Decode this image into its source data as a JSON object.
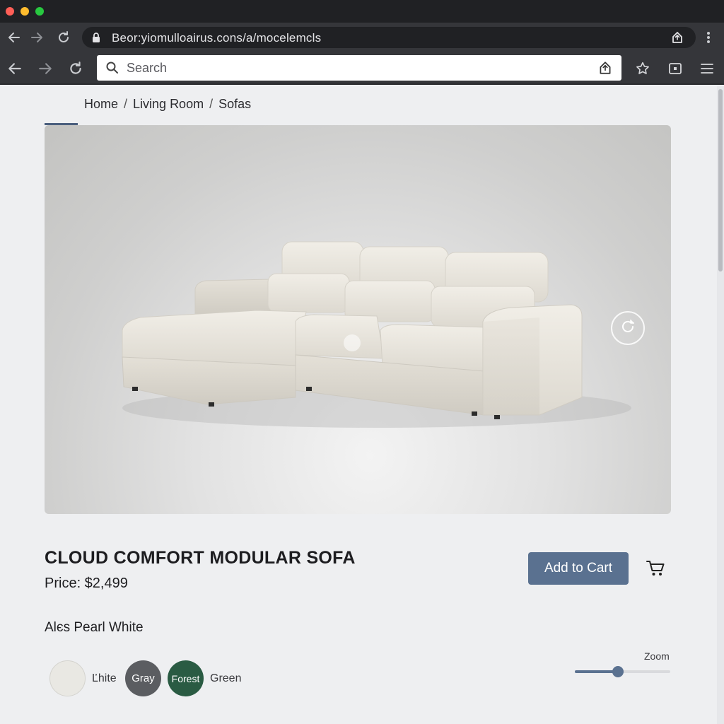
{
  "browser": {
    "url": "Beor:yiomulloairus.cons/a/mocelemcls",
    "search_placeholder": "Search"
  },
  "breadcrumb": {
    "items": [
      "Home",
      "Living Room",
      "Sofas"
    ],
    "separator": "/"
  },
  "product": {
    "title": "CLOUD COMFORT MODULAR SOFA",
    "price": "Price: $2,499",
    "add_to_cart_label": "Add to Cart",
    "selected_color_text": "Alєs Pearl White"
  },
  "color_options": {
    "white_label": "Ľhite",
    "gray_label": "Gray",
    "forest_label": "Forest",
    "green_label": "Green"
  },
  "zoom": {
    "label": "Zoom",
    "level": 0.45
  },
  "colors": {
    "accent": "#5a7190",
    "gray_swatch": "#5b5d61",
    "forest_swatch": "#2a5b43",
    "white_swatch": "#e9e8e3"
  },
  "icons": [
    "back-arrow-icon",
    "forward-arrow-icon",
    "reload-icon",
    "lock-icon",
    "share-icon",
    "menu-dots-icon",
    "search-icon",
    "extension-icon",
    "star-icon",
    "tab-icon",
    "hamburger-icon",
    "rotate-360-icon",
    "cart-icon"
  ]
}
